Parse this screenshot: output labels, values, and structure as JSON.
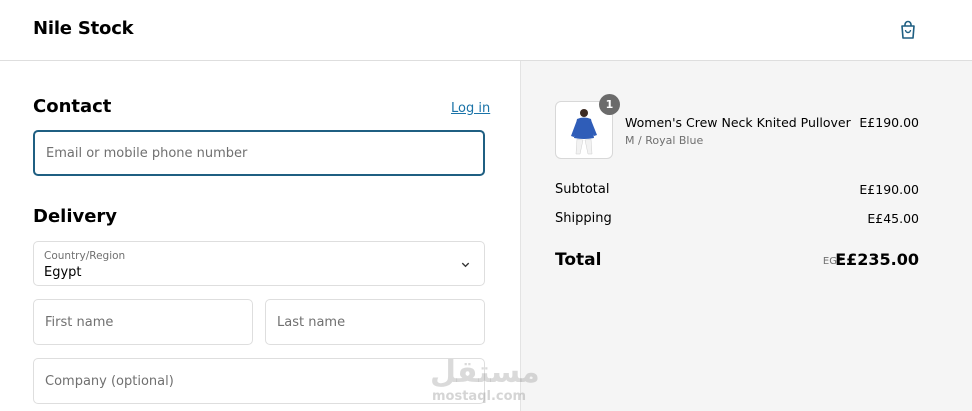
{
  "header": {
    "store_name": "Nile Stock",
    "cart_icon": "shopping-bag-icon",
    "accent_color": "#1f5f82"
  },
  "contact": {
    "title": "Contact",
    "login_label": "Log in",
    "email_placeholder": "Email or mobile phone number",
    "email_value": ""
  },
  "delivery": {
    "title": "Delivery",
    "country_label": "Country/Region",
    "country_value": "Egypt",
    "first_name_placeholder": "First name",
    "last_name_placeholder": "Last name",
    "company_placeholder": "Company (optional)"
  },
  "order": {
    "item": {
      "name": "Women's Crew Neck Knited Pullover",
      "variant": "M / Royal Blue",
      "price": "E£190.00",
      "quantity": "1"
    },
    "subtotal_label": "Subtotal",
    "subtotal_value": "E£190.00",
    "shipping_label": "Shipping",
    "shipping_value": "E£45.00",
    "total_label": "Total",
    "total_currency": "EGP",
    "total_value": "E£235.00"
  },
  "watermark": {
    "arabic": "مستقل",
    "latin": "mostaql.com"
  }
}
